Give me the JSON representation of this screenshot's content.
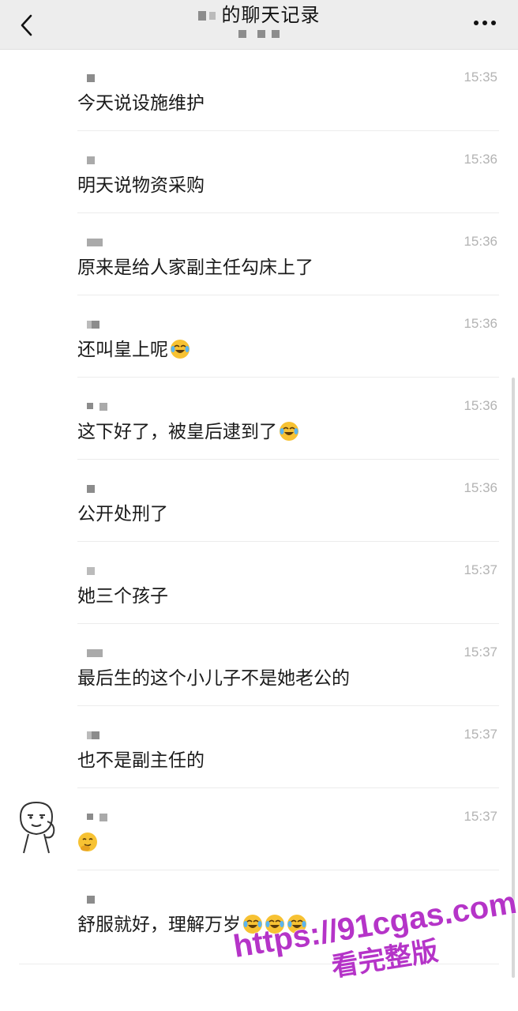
{
  "header": {
    "title": "的聊天记录",
    "back_icon": "chevron-left-icon",
    "more_icon": "ellipsis-icon"
  },
  "messages": [
    {
      "time": "15:35",
      "text": "今天说设施维护",
      "emoji_count": 0,
      "emoji": ""
    },
    {
      "time": "15:36",
      "text": "明天说物资采购",
      "emoji_count": 0,
      "emoji": ""
    },
    {
      "time": "15:36",
      "text": "原来是给人家副主任勾床上了",
      "emoji_count": 0,
      "emoji": ""
    },
    {
      "time": "15:36",
      "text": "还叫皇上呢",
      "emoji_count": 1,
      "emoji": "laugh-cry-emoji"
    },
    {
      "time": "15:36",
      "text": "这下好了，被皇后逮到了",
      "emoji_count": 1,
      "emoji": "laugh-cry-emoji"
    },
    {
      "time": "15:36",
      "text": "公开处刑了",
      "emoji_count": 0,
      "emoji": ""
    },
    {
      "time": "15:37",
      "text": "她三个孩子",
      "emoji_count": 0,
      "emoji": ""
    },
    {
      "time": "15:37",
      "text": "最后生的这个小儿子不是她老公的",
      "emoji_count": 0,
      "emoji": ""
    },
    {
      "time": "15:37",
      "text": "也不是副主任的",
      "emoji_count": 0,
      "emoji": ""
    },
    {
      "time": "15:37",
      "text": "",
      "emoji_count": 1,
      "emoji": "thinking-giggle-emoji"
    },
    {
      "time": "",
      "text": "舒服就好，理解万岁",
      "emoji_count": 3,
      "emoji": "laugh-cry-emoji"
    }
  ],
  "watermark": {
    "url": "https://91cgas.com",
    "caption": "看完整版",
    "color": "#b534c8"
  },
  "colors": {
    "header_bg": "#ededed",
    "time_text": "#b3b3b3",
    "divider": "#ececec"
  }
}
